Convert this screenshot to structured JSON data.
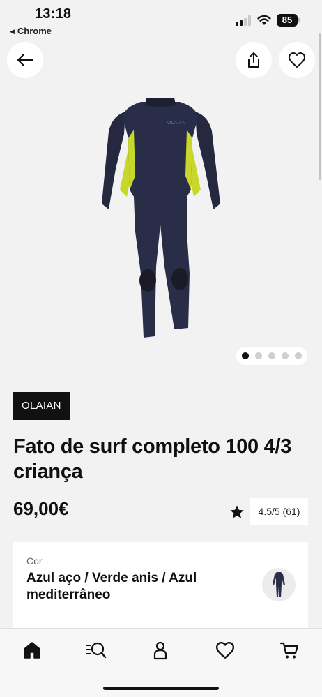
{
  "status_bar": {
    "time": "13:18",
    "back_app": "Chrome",
    "battery_level": "85"
  },
  "header": {
    "back_icon": "arrow-left-icon",
    "share_icon": "share-icon",
    "favorite_icon": "heart-icon"
  },
  "product": {
    "image_alt": "wetsuit-image",
    "chest_logo": "OLAIAN",
    "gallery": {
      "total": 5,
      "active_index": 0
    },
    "brand": "OLAIAN",
    "title": "Fato de surf completo 100 4/3 criança",
    "price": "69,00€",
    "rating": "4.5/5 (61)",
    "color_label": "Cor",
    "color_value": "Azul aço / Verde anis / Azul mediterrâneo"
  },
  "nav": {
    "items": [
      {
        "icon": "home-icon",
        "active": true
      },
      {
        "icon": "search-list-icon",
        "active": false
      },
      {
        "icon": "account-icon",
        "active": false
      },
      {
        "icon": "heart-icon",
        "active": false
      },
      {
        "icon": "cart-icon",
        "active": false
      }
    ]
  },
  "colors": {
    "background": "#f2f2f2",
    "wetsuit_navy": "#23263f",
    "accent_lime": "#c7d82a",
    "badge": "#111111"
  }
}
